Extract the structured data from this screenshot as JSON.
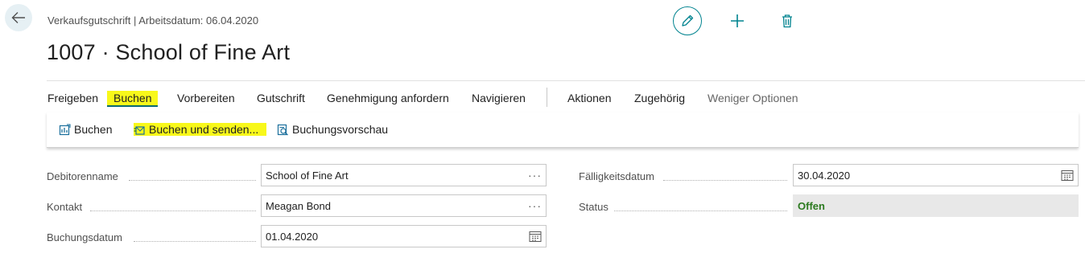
{
  "header": {
    "breadcrumb": "Verkaufsgutschrift | Arbeitsdatum: 06.04.2020",
    "title": "1007 · School of Fine Art"
  },
  "actions": {
    "back_icon": "arrow-left-icon",
    "edit_icon": "pencil-icon",
    "new_icon": "plus-icon",
    "delete_icon": "trash-icon"
  },
  "menu": {
    "items": [
      "Freigeben",
      "Buchen",
      "Vorbereiten",
      "Gutschrift",
      "Genehmigung anfordern",
      "Navigieren"
    ],
    "secondary": [
      "Aktionen",
      "Zugehörig",
      "Weniger Optionen"
    ],
    "active": "Buchen"
  },
  "submenu": {
    "items": [
      "Buchen",
      "Buchen und senden...",
      "Buchungsvorschau"
    ]
  },
  "form": {
    "customer_name_label": "Debitorenname",
    "customer_name_value": "School of Fine Art",
    "contact_label": "Kontakt",
    "contact_value": "Meagan Bond",
    "posting_date_label": "Buchungsdatum",
    "posting_date_value": "01.04.2020",
    "due_date_label": "Fälligkeitsdatum",
    "due_date_value": "30.04.2020",
    "status_label": "Status",
    "status_value": "Offen",
    "ellipsis": "···"
  },
  "colors": {
    "accent": "#00838f",
    "highlight": "#f8f81a",
    "status_green": "#2b7a1f"
  }
}
